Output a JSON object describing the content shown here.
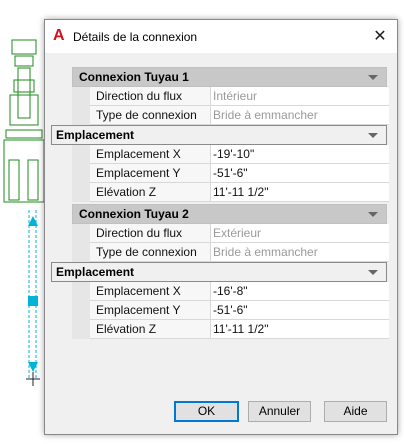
{
  "dialog": {
    "title": "Détails de la connexion",
    "close_glyph": "✕"
  },
  "sections": [
    {
      "label": "Connexion Tuyau 1",
      "rows": [
        {
          "name": "Direction du flux",
          "value": "Intérieur",
          "readonly": true
        },
        {
          "name": "Type de connexion",
          "value": "Bride à emmancher",
          "readonly": true
        }
      ],
      "sub": {
        "label": "Emplacement",
        "rows": [
          {
            "name": "Emplacement X",
            "value": "-19'-10\""
          },
          {
            "name": "Emplacement Y",
            "value": "-51'-6\""
          },
          {
            "name": "Elévation Z",
            "value": "11'-11 1/2\""
          }
        ]
      }
    },
    {
      "label": "Connexion Tuyau 2",
      "rows": [
        {
          "name": "Direction du flux",
          "value": "Extérieur",
          "readonly": true
        },
        {
          "name": "Type de connexion",
          "value": "Bride à emmancher",
          "readonly": true
        }
      ],
      "sub": {
        "label": "Emplacement",
        "rows": [
          {
            "name": "Emplacement X",
            "value": "-16'-8\""
          },
          {
            "name": "Emplacement Y",
            "value": "-51'-6\""
          },
          {
            "name": "Elévation Z",
            "value": "11'-11 1/2\""
          }
        ]
      }
    }
  ],
  "buttons": {
    "ok": "OK",
    "cancel": "Annuler",
    "help": "Aide"
  },
  "colors": {
    "accent": "#0078d7",
    "app_icon": "#d0141c",
    "cad_green": "#1f8a1f",
    "cad_cyan": "#00b4d8"
  },
  "icons": {
    "app": "autocad-a-icon",
    "close": "close-icon",
    "collapse": "chevron-down-icon"
  }
}
